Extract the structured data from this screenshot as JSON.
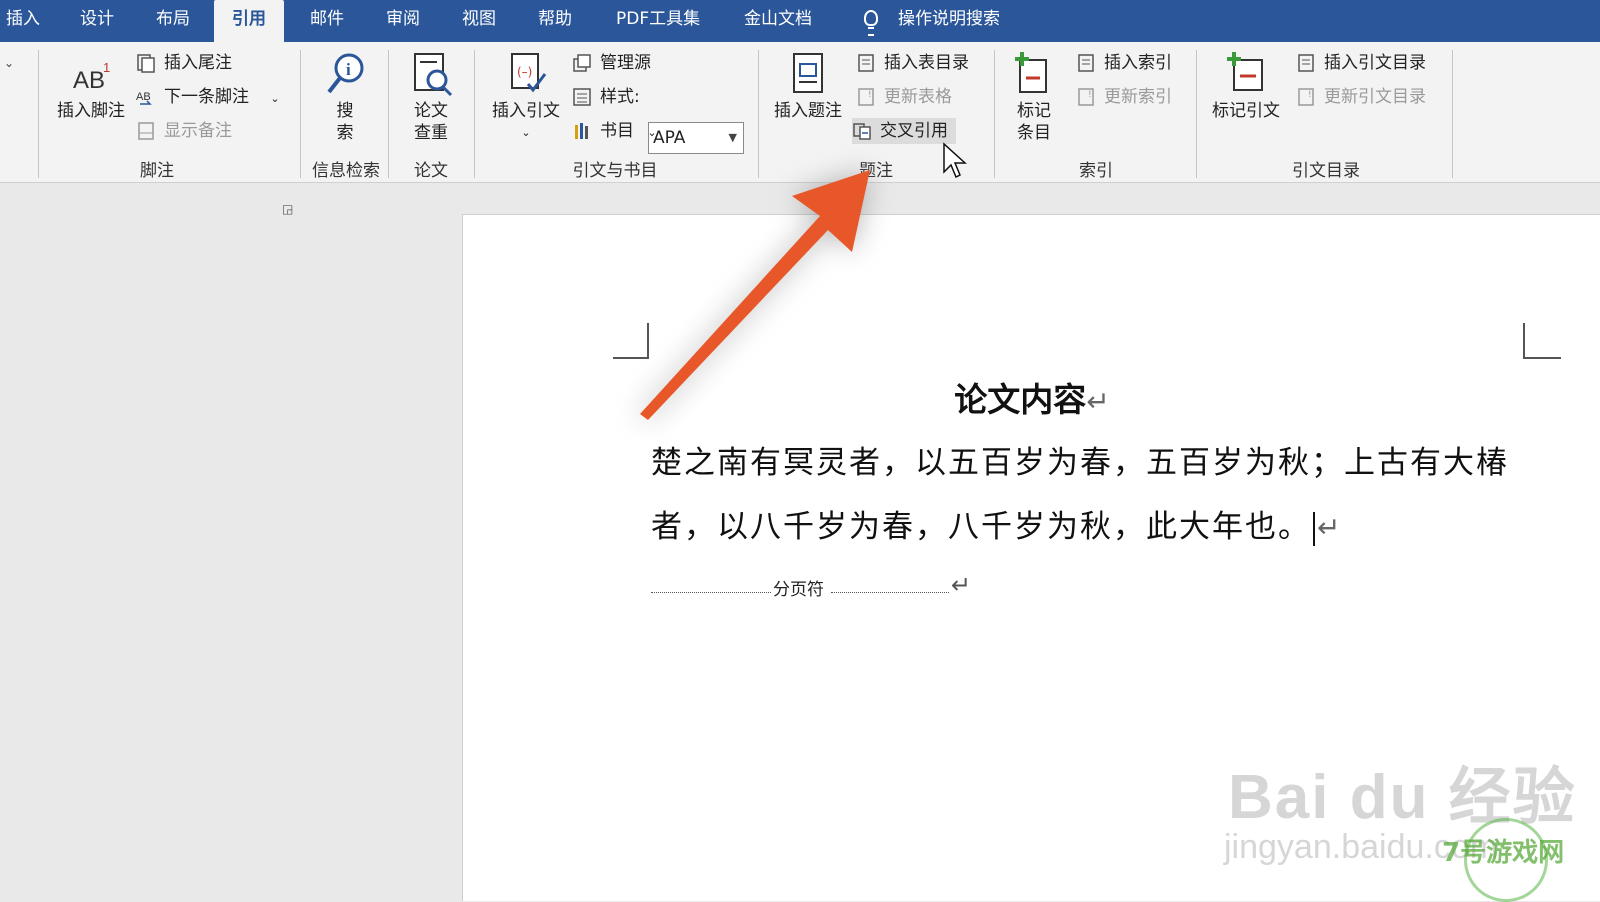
{
  "tabs": {
    "items": [
      "插入",
      "设计",
      "布局",
      "引用",
      "邮件",
      "审阅",
      "视图",
      "帮助",
      "PDF工具集",
      "金山文档"
    ],
    "active": "引用",
    "tell_me": "操作说明搜索"
  },
  "ribbon": {
    "footnotes": {
      "label": "脚注",
      "insert_footnote": "插入脚注",
      "insert_endnote": "插入尾注",
      "next_footnote": "下一条脚注",
      "show_notes": "显示备注"
    },
    "research": {
      "label": "信息检索",
      "search": "搜索"
    },
    "paper": {
      "label": "论文",
      "paper_check": "论文查重"
    },
    "citations": {
      "label": "引文与书目",
      "insert_citation": "插入引文",
      "manage_sources": "管理源",
      "style_label": "样式:",
      "style_value": "APA",
      "bibliography": "书目"
    },
    "captions": {
      "label": "题注",
      "insert_caption": "插入题注",
      "insert_table_of_figures": "插入表目录",
      "update_table": "更新表格",
      "cross_reference": "交叉引用"
    },
    "index": {
      "label": "索引",
      "mark_entry": "标记条目",
      "insert_index": "插入索引",
      "update_index": "更新索引"
    },
    "toa": {
      "label": "引文目录",
      "mark_citation": "标记引文",
      "insert_toa": "插入引文目录",
      "update_toa": "更新引文目录"
    }
  },
  "document": {
    "title": "论文内容",
    "line1": "楚之南有冥灵者，以五百岁为春，五百岁为秋；上古有大椿",
    "line2": "者，以八千岁为春，八千岁为秋，此大年也。",
    "page_break_label": "分页符",
    "paragraph_mark": "↵"
  },
  "watermark": {
    "brand": "Bai du 经验",
    "url": "jingyan.baidu.com",
    "site": "7号游戏网"
  },
  "colors": {
    "tabbar": "#2b579a",
    "arrow": "#e8572a"
  },
  "icons": [
    "footnote-icon",
    "endnote-icon",
    "next-footnote-icon",
    "show-notes-icon",
    "search-icon",
    "paper-check-icon",
    "insert-citation-icon",
    "manage-sources-icon",
    "style-icon",
    "bibliography-icon",
    "insert-caption-icon",
    "table-of-figures-icon",
    "update-table-icon",
    "cross-reference-icon",
    "mark-entry-icon",
    "insert-index-icon",
    "update-index-icon",
    "mark-citation-icon",
    "insert-toa-icon",
    "update-toa-icon",
    "lightbulb-icon",
    "mouse-cursor-icon",
    "arrow-annotation"
  ]
}
